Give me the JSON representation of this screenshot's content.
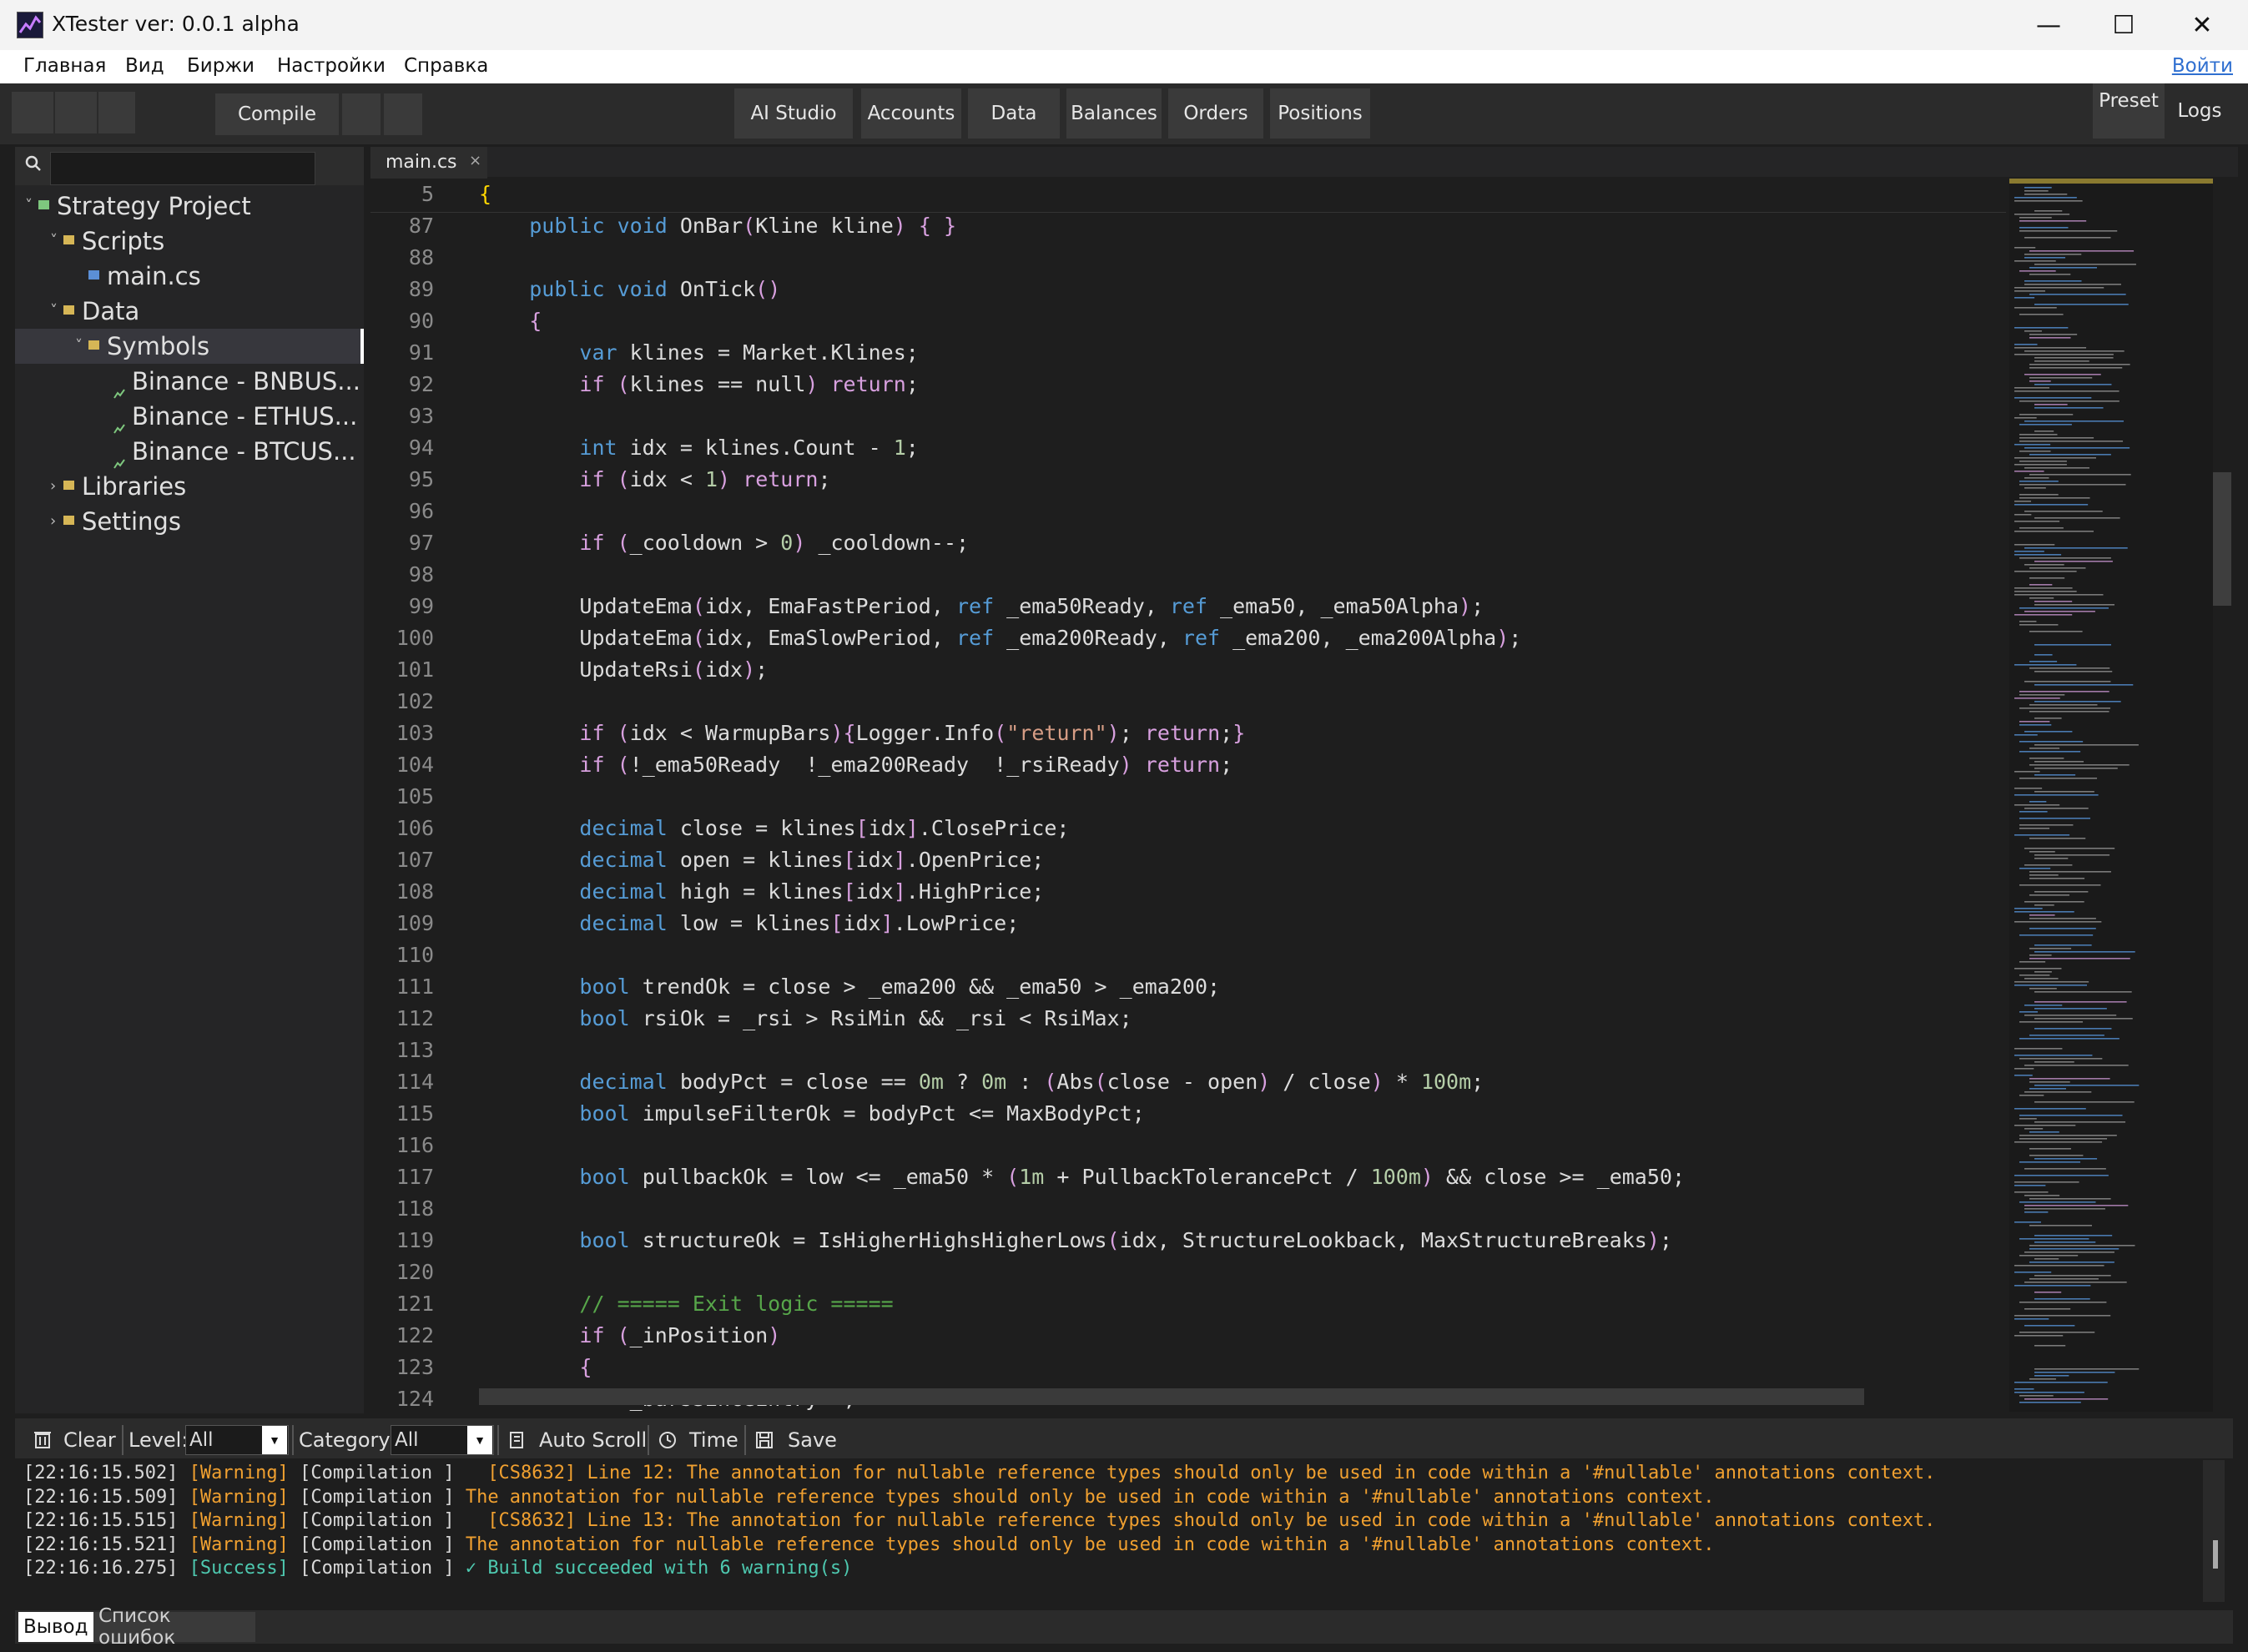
{
  "window": {
    "title": "XTester ver: 0.0.1 alpha"
  },
  "menu": {
    "items": [
      "Главная",
      "Вид",
      "Биржи",
      "Настройки",
      "Справка"
    ],
    "login": "Войти"
  },
  "toolbar": {
    "compile": "Compile",
    "tabs": [
      "AI Studio",
      "Accounts",
      "Data",
      "Balances",
      "Orders",
      "Positions"
    ],
    "preset": "Preset",
    "logs": "Logs"
  },
  "tree": {
    "items": [
      {
        "label": "Strategy Project",
        "level": 0,
        "expanded": true
      },
      {
        "label": "Scripts",
        "level": 1,
        "expanded": true
      },
      {
        "label": "main.cs",
        "level": 2
      },
      {
        "label": "Data",
        "level": 1,
        "expanded": true
      },
      {
        "label": "Symbols",
        "level": 2,
        "expanded": true,
        "selected": true
      },
      {
        "label": "Binance - BNBUS...",
        "level": 3
      },
      {
        "label": "Binance - ETHUS...",
        "level": 3
      },
      {
        "label": "Binance - BTCUS...",
        "level": 3
      },
      {
        "label": "Libraries",
        "level": 1,
        "expanded": false
      },
      {
        "label": "Settings",
        "level": 1,
        "expanded": false
      }
    ]
  },
  "editor": {
    "tab": "main.cs",
    "tab_close": "×",
    "sticky_line_number": "5",
    "sticky_line_text": "{",
    "lines": [
      {
        "n": "87",
        "t": "    public void OnBar(Kline kline) { }"
      },
      {
        "n": "88",
        "t": ""
      },
      {
        "n": "89",
        "t": "    public void OnTick()"
      },
      {
        "n": "90",
        "t": "    {"
      },
      {
        "n": "91",
        "t": "        var klines = Market.Klines;"
      },
      {
        "n": "92",
        "t": "        if (klines == null) return;"
      },
      {
        "n": "93",
        "t": ""
      },
      {
        "n": "94",
        "t": "        int idx = klines.Count - 1;"
      },
      {
        "n": "95",
        "t": "        if (idx < 1) return;"
      },
      {
        "n": "96",
        "t": ""
      },
      {
        "n": "97",
        "t": "        if (_cooldown > 0) _cooldown--;"
      },
      {
        "n": "98",
        "t": ""
      },
      {
        "n": "99",
        "t": "        UpdateEma(idx, EmaFastPeriod, ref _ema50Ready, ref _ema50, _ema50Alpha);"
      },
      {
        "n": "100",
        "t": "        UpdateEma(idx, EmaSlowPeriod, ref _ema200Ready, ref _ema200, _ema200Alpha);"
      },
      {
        "n": "101",
        "t": "        UpdateRsi(idx);"
      },
      {
        "n": "102",
        "t": ""
      },
      {
        "n": "103",
        "t": "        if (idx < WarmupBars){Logger.Info(\"return\"); return;}"
      },
      {
        "n": "104",
        "t": "        if (!_ema50Ready  !_ema200Ready  !_rsiReady) return;"
      },
      {
        "n": "105",
        "t": ""
      },
      {
        "n": "106",
        "t": "        decimal close = klines[idx].ClosePrice;"
      },
      {
        "n": "107",
        "t": "        decimal open = klines[idx].OpenPrice;"
      },
      {
        "n": "108",
        "t": "        decimal high = klines[idx].HighPrice;"
      },
      {
        "n": "109",
        "t": "        decimal low = klines[idx].LowPrice;"
      },
      {
        "n": "110",
        "t": ""
      },
      {
        "n": "111",
        "t": "        bool trendOk = close > _ema200 && _ema50 > _ema200;"
      },
      {
        "n": "112",
        "t": "        bool rsiOk = _rsi > RsiMin && _rsi < RsiMax;"
      },
      {
        "n": "113",
        "t": ""
      },
      {
        "n": "114",
        "t": "        decimal bodyPct = close == 0m ? 0m : (Abs(close - open) / close) * 100m;"
      },
      {
        "n": "115",
        "t": "        bool impulseFilterOk = bodyPct <= MaxBodyPct;"
      },
      {
        "n": "116",
        "t": ""
      },
      {
        "n": "117",
        "t": "        bool pullbackOk = low <= _ema50 * (1m + PullbackTolerancePct / 100m) && close >= _ema50;"
      },
      {
        "n": "118",
        "t": ""
      },
      {
        "n": "119",
        "t": "        bool structureOk = IsHigherHighsHigherLows(idx, StructureLookback, MaxStructureBreaks);"
      },
      {
        "n": "120",
        "t": ""
      },
      {
        "n": "121",
        "t": "        // ===== Exit logic ====="
      },
      {
        "n": "122",
        "t": "        if (_inPosition)"
      },
      {
        "n": "123",
        "t": "        {"
      },
      {
        "n": "124",
        "t": "            _barsSinceEntry++;"
      }
    ]
  },
  "output": {
    "clear": "Clear",
    "level_label": "Level:",
    "level_value": "All",
    "category_label": "Category:",
    "category_value": "All",
    "auto_scroll": "Auto Scroll",
    "time": "Time",
    "save": "Save",
    "logs": [
      {
        "time": "[22:16:15.502]",
        "level": "[Warning]",
        "cat": "[Compilation ]",
        "msg": "  [CS8632] Line 12: The annotation for nullable reference types should only be used in code within a '#nullable' annotations context.",
        "kind": "warning"
      },
      {
        "time": "[22:16:15.509]",
        "level": "[Warning]",
        "cat": "[Compilation ]",
        "msg": "The annotation for nullable reference types should only be used in code within a '#nullable' annotations context.",
        "kind": "warning"
      },
      {
        "time": "[22:16:15.515]",
        "level": "[Warning]",
        "cat": "[Compilation ]",
        "msg": "  [CS8632] Line 13: The annotation for nullable reference types should only be used in code within a '#nullable' annotations context.",
        "kind": "warning"
      },
      {
        "time": "[22:16:15.521]",
        "level": "[Warning]",
        "cat": "[Compilation ]",
        "msg": "The annotation for nullable reference types should only be used in code within a '#nullable' annotations context.",
        "kind": "warning"
      },
      {
        "time": "[22:16:16.275]",
        "level": "[Success]",
        "cat": "[Compilation ]",
        "msg": "✓ Build succeeded with 6 warning(s)",
        "kind": "success"
      }
    ]
  },
  "bottom_tabs": [
    "Вывод",
    "Список ошибок"
  ],
  "icons": {
    "app": "chart-app-icon",
    "minimize": "minimize-icon",
    "maximize": "maximize-icon",
    "close": "close-icon",
    "search": "search-icon",
    "folder": "folder-icon",
    "file": "csharp-file-icon",
    "symbol": "chart-symbol-icon",
    "clear": "trash-icon",
    "autoscroll": "scroll-icon",
    "time": "clock-icon",
    "save": "save-icon"
  },
  "colors": {
    "editor_bg": "#1e1e1e",
    "keyword": "#569cd6",
    "control_keyword": "#d8a0df",
    "string": "#d69d85",
    "number": "#b5cea8",
    "comment": "#57a64a",
    "warning": "#f0a030",
    "success": "#4ec9b0",
    "link": "#2f6fd0"
  }
}
